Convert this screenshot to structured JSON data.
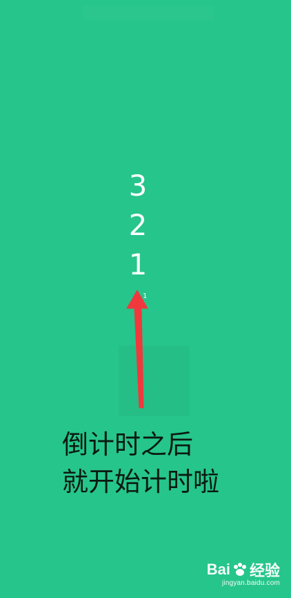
{
  "countdown": {
    "numbers": [
      "3",
      "2",
      "1"
    ]
  },
  "marker_label": "1",
  "caption": {
    "line1": "倒计时之后",
    "line2": "就开始计时啦"
  },
  "watermark": {
    "brand_prefix": "Bai",
    "brand_suffix": "经验",
    "url": "jingyan.baidu.com"
  },
  "colors": {
    "background": "#26c58b",
    "arrow": "#f0393d",
    "text": "#ffffff",
    "caption": "#0b1a12"
  }
}
